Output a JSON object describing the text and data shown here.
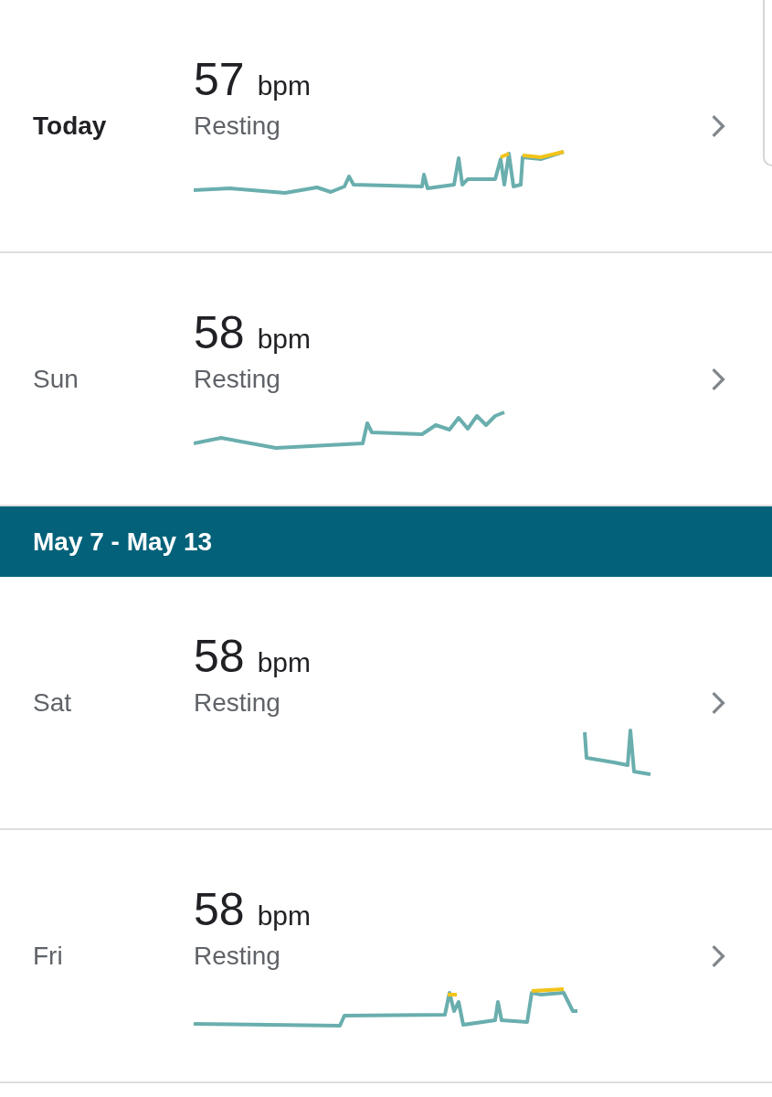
{
  "sections": [
    {
      "entries": [
        {
          "day": "Today",
          "current": true,
          "value": "57",
          "unit": "bpm",
          "label": "Resting"
        },
        {
          "day": "Sun",
          "current": false,
          "value": "58",
          "unit": "bpm",
          "label": "Resting"
        }
      ]
    },
    {
      "header": "May 7 - May 13",
      "entries": [
        {
          "day": "Sat",
          "current": false,
          "value": "58",
          "unit": "bpm",
          "label": "Resting"
        },
        {
          "day": "Fri",
          "current": false,
          "value": "58",
          "unit": "bpm",
          "label": "Resting"
        }
      ]
    }
  ]
}
